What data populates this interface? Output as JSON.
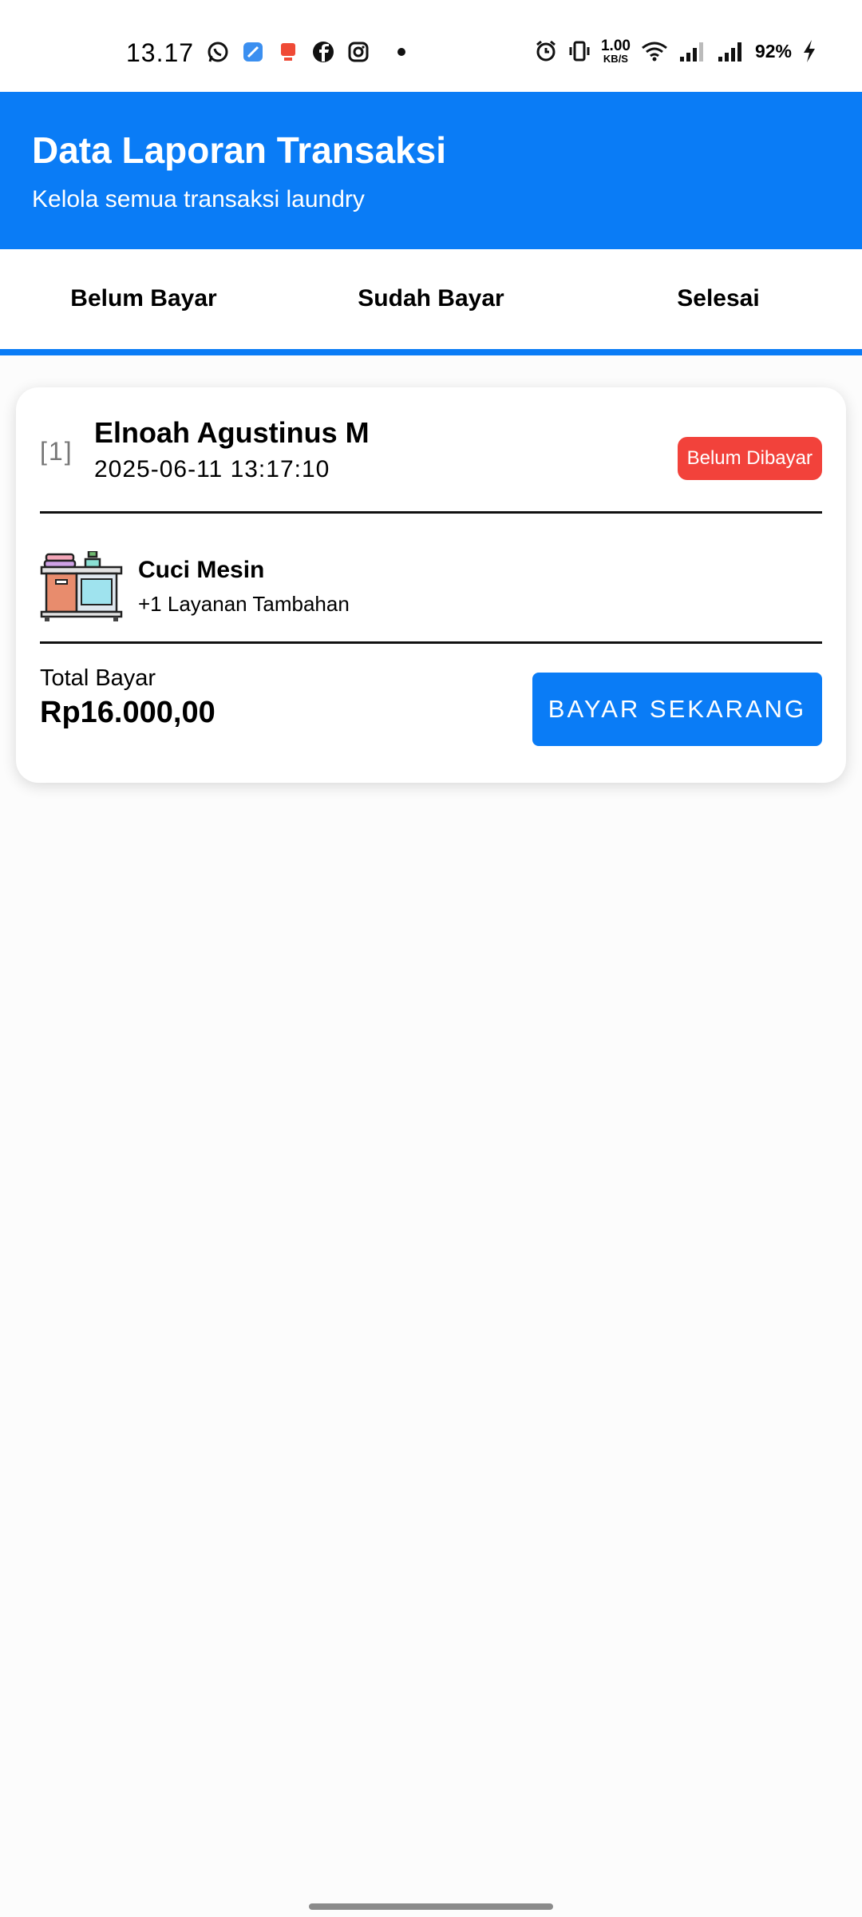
{
  "status_bar": {
    "time": "13.17",
    "left_icons": [
      "whatsapp-icon",
      "blue-app-icon",
      "shop-pay-icon",
      "facebook-icon",
      "instagram-icon",
      "notification-dot-icon"
    ],
    "net_speed_value": "1.00",
    "net_speed_unit": "KB/S",
    "battery_percent": "92%",
    "right_icons": [
      "alarm-icon",
      "vibrate-icon",
      "wifi-icon",
      "signal-sim1-icon",
      "signal-sim2-icon",
      "charging-bolt-icon"
    ]
  },
  "header": {
    "title": "Data Laporan Transaksi",
    "subtitle": "Kelola semua transaksi laundry",
    "background": "#0a7cf6"
  },
  "tabs": [
    {
      "label": "Belum Bayar",
      "active": true
    },
    {
      "label": "Sudah Bayar",
      "active": false
    },
    {
      "label": "Selesai",
      "active": false
    }
  ],
  "transactions": [
    {
      "index": "[1]",
      "customer_name": "Elnoah Agustinus M",
      "datetime": "2025-06-11 13:17:10",
      "status": "Belum Dibayar",
      "status_color": "#f2423b",
      "service_icon": "laundry-shelf-icon",
      "service_name": "Cuci Mesin",
      "service_extra": "+1 Layanan Tambahan",
      "total_label": "Total Bayar",
      "total_amount": "Rp16.000,00",
      "action_label": "BAYAR SEKARANG"
    }
  ]
}
